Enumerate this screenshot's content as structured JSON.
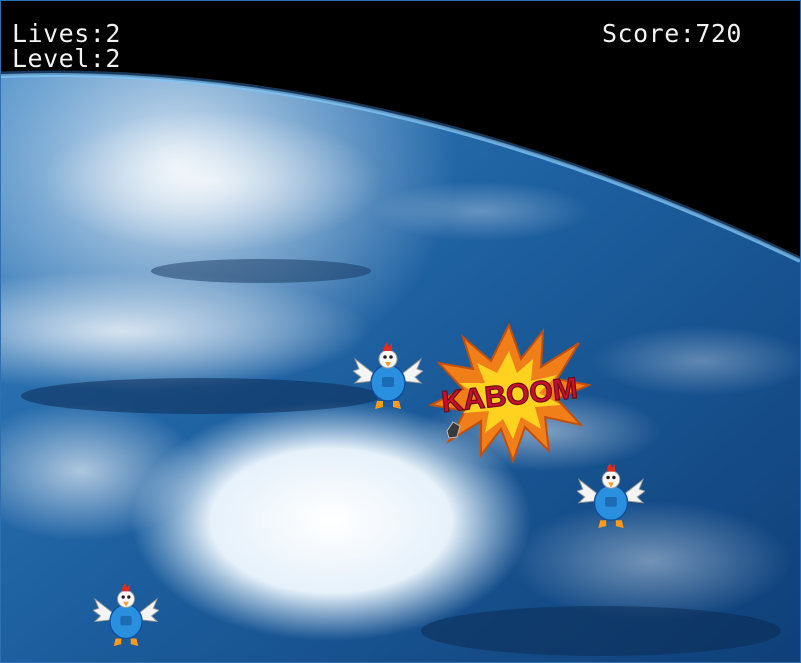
{
  "hud": {
    "lives_label": "Lives:",
    "lives_value": "2",
    "level_label": "Level:",
    "level_value": "2",
    "score_label": "Score:",
    "score_value": "720"
  },
  "explosion": {
    "text": "KABOOM"
  },
  "scene": {
    "background": "earth-from-orbit",
    "sprites": [
      "chicken-sprite",
      "chicken-sprite",
      "chicken-sprite",
      "explosion-burst",
      "debris"
    ]
  },
  "colors": {
    "hud_text": "#f2f2f2",
    "space": "#000000",
    "ocean": "#1f5fa0",
    "cloud": "#eaf4fb",
    "kaboom_text": "#c8102e",
    "burst_outer": "#f07f1a",
    "burst_inner": "#ffd21f",
    "chicken_body": "#2b8fe0",
    "chicken_beak": "#ff9a1a",
    "chicken_comb": "#e52b1d"
  }
}
